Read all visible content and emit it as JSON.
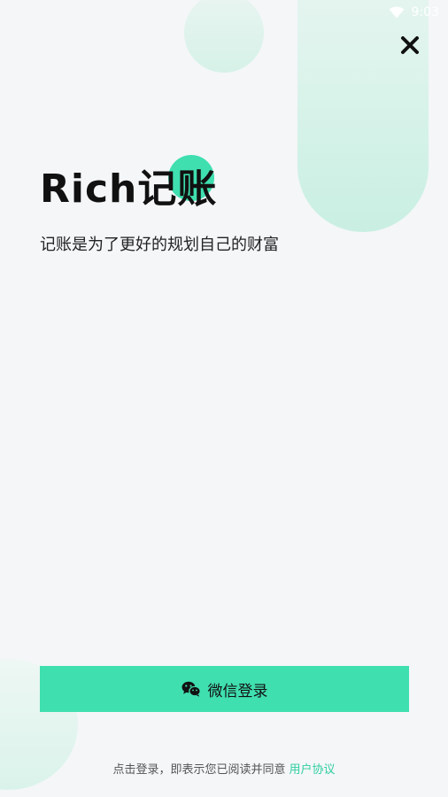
{
  "status_bar": {
    "time": "9:03",
    "wifi_icon": "wifi-icon"
  },
  "header": {
    "close_icon": "close-icon"
  },
  "app": {
    "title": "Rich记账",
    "subtitle": "记账是为了更好的规划自己的财富"
  },
  "login": {
    "wechat_button_label": "微信登录",
    "wechat_icon": "wechat-icon"
  },
  "agreement": {
    "text": "点击登录，即表示您已阅读并同意",
    "link_label": "用户协议"
  },
  "colors": {
    "accent": "#40dfb0",
    "link": "#2fcf9e",
    "background": "#f4f6f8",
    "title_dot": "#3fdfb0"
  }
}
